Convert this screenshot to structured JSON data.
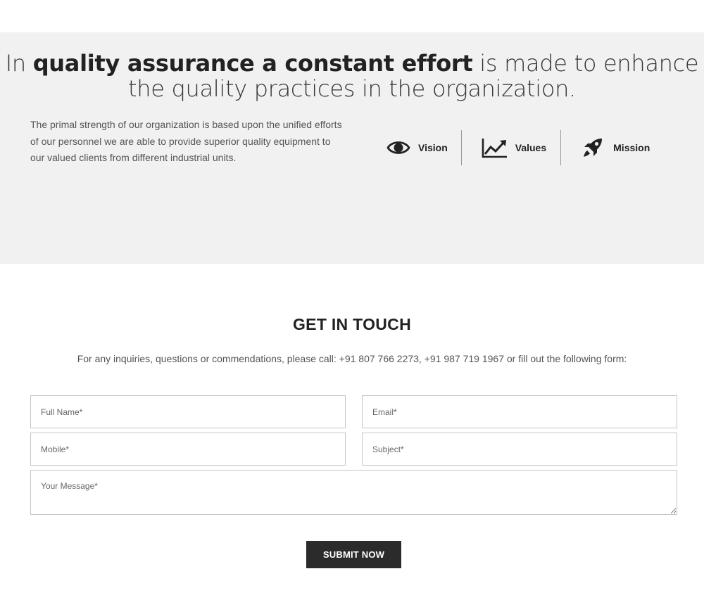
{
  "quality": {
    "headline": {
      "lead": "In ",
      "bold": "quality assurance a constant effort",
      "rest": " is made to enhance",
      "line2": "the quality practices in the organization."
    },
    "intro": "The primal strength of our organization is based upon the unified efforts of our personnel we are able to provide superior quality equipment to our valued clients from different industrial units.",
    "pillars": [
      {
        "label": "Vision",
        "icon": "eye-icon"
      },
      {
        "label": "Values",
        "icon": "trending-chart-icon"
      },
      {
        "label": "Mission",
        "icon": "rocket-icon"
      }
    ]
  },
  "contact": {
    "title": "GET IN TOUCH",
    "text": "For any inquiries, questions or commendations, please call: +91 807 766 2273, +91 987 719 1967 or fill out the following form:",
    "form": {
      "full_name_placeholder": "Full Name*",
      "email_placeholder": "Email*",
      "mobile_placeholder": "Mobile*",
      "subject_placeholder": "Subject*",
      "message_placeholder": "Your Message*",
      "submit_label": "SUBMIT NOW"
    }
  },
  "colors": {
    "section_bg": "#f1f1f1",
    "button_bg": "#2b2b2b",
    "text_dark": "#222222",
    "field_border": "#c6c6c6"
  }
}
